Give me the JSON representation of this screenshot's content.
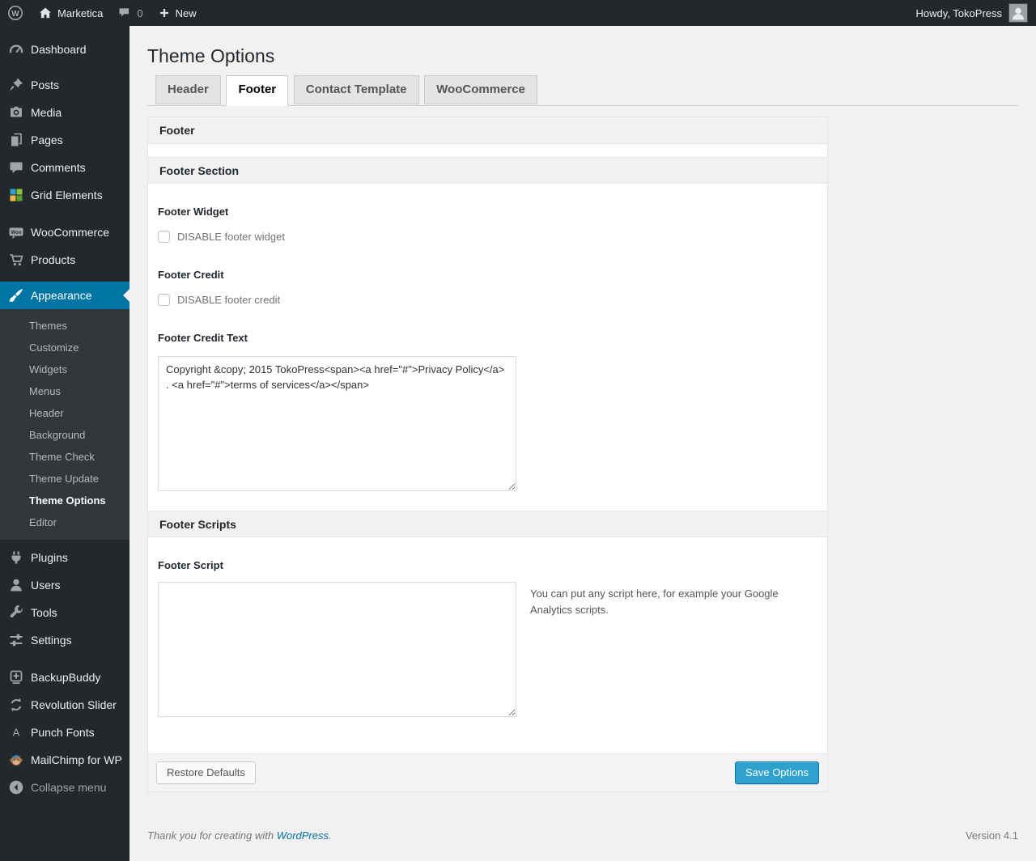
{
  "colors": {
    "accent": "#0074a2",
    "primary_button": "#2ea2cc",
    "admin_bar_bg": "#23282d",
    "menu_bg": "#23282d",
    "submenu_bg": "#32373c",
    "page_bg": "#f1f1f1"
  },
  "admin_bar": {
    "site_name": "Marketica",
    "comment_count": "0",
    "new_label": "New",
    "howdy_text": "Howdy, TokoPress"
  },
  "icons": {
    "wp_logo_letter": "W",
    "woo_badge_text": "Woo",
    "punch_fonts_letter": "A"
  },
  "sidebar": {
    "items": [
      {
        "label": "Dashboard"
      },
      {
        "label": "Posts"
      },
      {
        "label": "Media"
      },
      {
        "label": "Pages"
      },
      {
        "label": "Comments"
      },
      {
        "label": "Grid Elements"
      },
      {
        "label": "WooCommerce"
      },
      {
        "label": "Products"
      },
      {
        "label": "Appearance",
        "current": true
      },
      {
        "label": "Plugins"
      },
      {
        "label": "Users"
      },
      {
        "label": "Tools"
      },
      {
        "label": "Settings"
      },
      {
        "label": "BackupBuddy"
      },
      {
        "label": "Revolution Slider"
      },
      {
        "label": "Punch Fonts"
      },
      {
        "label": "MailChimp for WP"
      },
      {
        "label": "Collapse menu"
      }
    ],
    "appearance_submenu": [
      {
        "label": "Themes"
      },
      {
        "label": "Customize"
      },
      {
        "label": "Widgets"
      },
      {
        "label": "Menus"
      },
      {
        "label": "Header"
      },
      {
        "label": "Background"
      },
      {
        "label": "Theme Check"
      },
      {
        "label": "Theme Update"
      },
      {
        "label": "Theme Options",
        "current": true
      },
      {
        "label": "Editor"
      }
    ]
  },
  "page": {
    "title": "Theme Options",
    "tabs": [
      {
        "label": "Header",
        "active": false
      },
      {
        "label": "Footer",
        "active": true
      },
      {
        "label": "Contact Template",
        "active": false
      },
      {
        "label": "WooCommerce",
        "active": false
      }
    ]
  },
  "panel": {
    "box_header": "Footer",
    "footer_section_header": "Footer Section",
    "footer_widget": {
      "label": "Footer Widget",
      "checkbox_label": "DISABLE footer widget",
      "checked": false
    },
    "footer_credit": {
      "label": "Footer Credit",
      "checkbox_label": "DISABLE footer credit",
      "checked": false
    },
    "footer_credit_text": {
      "label": "Footer Credit Text",
      "value": "Copyright &copy; 2015 TokoPress<span><a href=\"#\">Privacy Policy</a> . <a href=\"#\">terms of services</a></span>"
    },
    "footer_scripts_header": "Footer Scripts",
    "footer_script": {
      "label": "Footer Script",
      "value": "",
      "help": "You can put any script here, for example your Google Analytics scripts."
    },
    "buttons": {
      "restore": "Restore Defaults",
      "save": "Save Options"
    }
  },
  "page_footer": {
    "thanks_text": "Thank you for creating with ",
    "link_label": "WordPress",
    "suffix": ".",
    "version": "Version 4.1"
  }
}
